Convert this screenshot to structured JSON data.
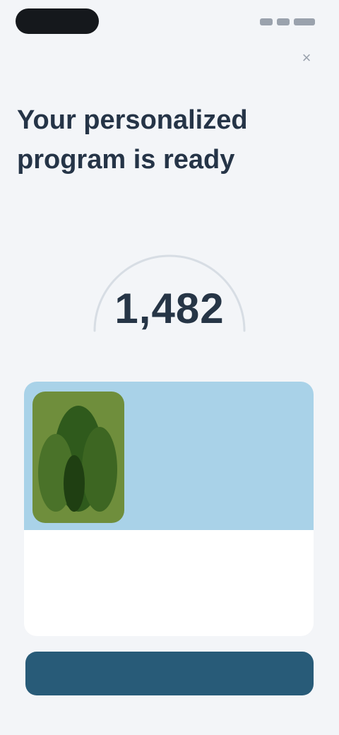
{
  "status_bar": {
    "time": ""
  },
  "close": {
    "label": "×"
  },
  "title": "Your personalized program is ready",
  "subtitle": "",
  "score": {
    "value": "1,482"
  },
  "card": {
    "banner_text": "",
    "text": ""
  },
  "note": "",
  "cta": {
    "label": ""
  },
  "colors": {
    "accent": "#285b78",
    "banner": "#a9d2e8",
    "plant": "#6f8e3c"
  }
}
